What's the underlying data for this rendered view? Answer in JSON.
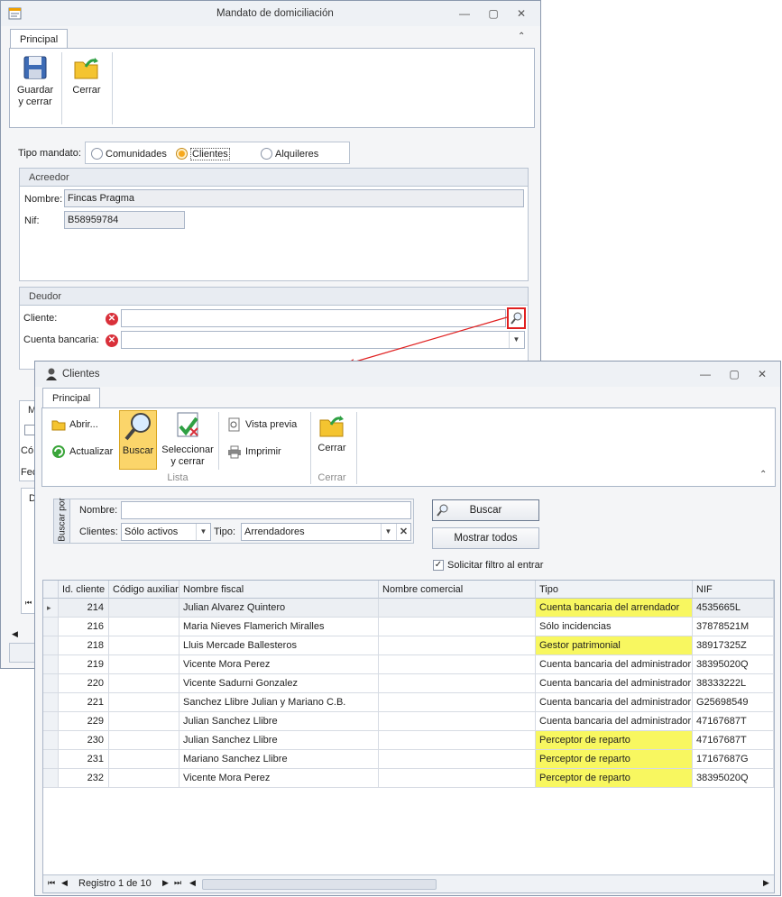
{
  "main_window": {
    "title": "Mandato de domiciliación",
    "tab": "Principal",
    "ribbon": {
      "save_label_1": "Guardar",
      "save_label_2": "y cerrar",
      "close_label": "Cerrar"
    },
    "tipo_mandato": {
      "label": "Tipo mandato:",
      "options": [
        "Comunidades",
        "Clientes",
        "Alquileres"
      ],
      "selected": "Clientes"
    },
    "acreedor": {
      "header": "Acreedor",
      "nombre_label": "Nombre:",
      "nombre_value": "Fincas Pragma",
      "nif_label": "Nif:",
      "nif_value": "B58959784"
    },
    "deudor": {
      "header": "Deudor",
      "cliente_label": "Cliente:",
      "cliente_value": "",
      "cuenta_label": "Cuenta bancaria:",
      "cuenta_value": ""
    },
    "partial": {
      "m": "M",
      "co": "Có",
      "fec": "Fec",
      "d": "D"
    }
  },
  "clients_window": {
    "title": "Clientes",
    "tab": "Principal",
    "ribbon": {
      "abrir": "Abrir...",
      "actualizar": "Actualizar",
      "buscar": "Buscar",
      "seleccionar_1": "Seleccionar",
      "seleccionar_2": "y cerrar",
      "vista_previa": "Vista previa",
      "imprimir": "Imprimir",
      "cerrar": "Cerrar",
      "group_lista": "Lista",
      "group_cerrar": "Cerrar"
    },
    "search": {
      "side_label": "Buscar por",
      "nombre_label": "Nombre:",
      "nombre_value": "",
      "clientes_label": "Clientes:",
      "clientes_value": "Sólo activos",
      "tipo_label": "Tipo:",
      "tipo_value": "Arrendadores",
      "buscar_button": "Buscar",
      "mostrar_button": "Mostrar todos",
      "solicitar_label": "Solicitar filtro al entrar",
      "solicitar_checked": true
    },
    "grid": {
      "columns": [
        "Id. cliente",
        "Código auxiliar",
        "Nombre fiscal",
        "Nombre comercial",
        "Tipo",
        "NIF"
      ],
      "rows": [
        {
          "id": "214",
          "aux": "",
          "fiscal": "Julian Alvarez Quintero",
          "comercial": "",
          "tipo": "Cuenta bancaria del arrendador",
          "nif": "4535665L",
          "hl": true
        },
        {
          "id": "216",
          "aux": "",
          "fiscal": "Maria Nieves Flamerich Miralles",
          "comercial": "",
          "tipo": "Sólo incidencias",
          "nif": "37878521M",
          "hl": false
        },
        {
          "id": "218",
          "aux": "",
          "fiscal": "Lluis Mercade Ballesteros",
          "comercial": "",
          "tipo": "Gestor patrimonial",
          "nif": "38917325Z",
          "hl": true
        },
        {
          "id": "219",
          "aux": "",
          "fiscal": "Vicente Mora Perez",
          "comercial": "",
          "tipo": "Cuenta bancaria del administrador",
          "nif": "38395020Q",
          "hl": false
        },
        {
          "id": "220",
          "aux": "",
          "fiscal": "Vicente Sadurni Gonzalez",
          "comercial": "",
          "tipo": "Cuenta bancaria del administrador",
          "nif": "38333222L",
          "hl": false
        },
        {
          "id": "221",
          "aux": "",
          "fiscal": "Sanchez Llibre Julian y Mariano C.B.",
          "comercial": "",
          "tipo": "Cuenta bancaria del administrador",
          "nif": "G25698549",
          "hl": false
        },
        {
          "id": "229",
          "aux": "",
          "fiscal": "Julian Sanchez Llibre",
          "comercial": "",
          "tipo": "Cuenta bancaria del administrador",
          "nif": "47167687T",
          "hl": false
        },
        {
          "id": "230",
          "aux": "",
          "fiscal": "Julian Sanchez Llibre",
          "comercial": "",
          "tipo": "Perceptor de reparto",
          "nif": "47167687T",
          "hl": true
        },
        {
          "id": "231",
          "aux": "",
          "fiscal": "Mariano Sanchez Llibre",
          "comercial": "",
          "tipo": "Perceptor de reparto",
          "nif": "17167687G",
          "hl": true
        },
        {
          "id": "232",
          "aux": "",
          "fiscal": "Vicente Mora Perez",
          "comercial": "",
          "tipo": "Perceptor de reparto",
          "nif": "38395020Q",
          "hl": true
        }
      ]
    },
    "status": "Registro 1 de 10",
    "colors": {
      "highlight": "#f8f760",
      "accent": "#f7a81c",
      "error": "#d9303a"
    }
  }
}
